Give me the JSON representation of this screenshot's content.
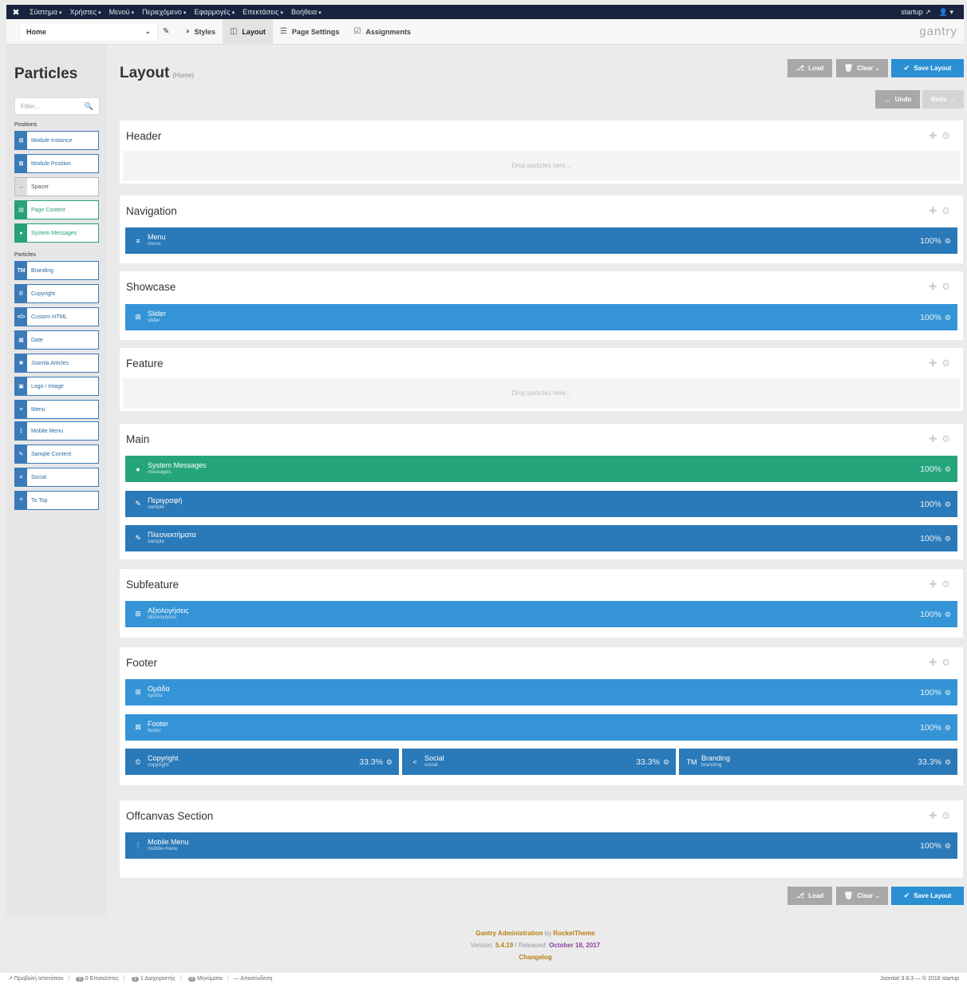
{
  "topbar": {
    "menus": [
      "Σύστημα",
      "Χρήστες",
      "Μενού",
      "Περιεχόμενο",
      "Εφαρμογές",
      "Επεκτάσεις",
      "Βοήθεια"
    ],
    "site_label": "startup"
  },
  "toolbar": {
    "template": "Home",
    "tabs": [
      "Styles",
      "Layout",
      "Page Settings",
      "Assignments"
    ],
    "brand": "gantry"
  },
  "sidebar": {
    "title": "Particles",
    "filter_placeholder": "Filter...",
    "positions_label": "Positions",
    "particles_label": "Particles",
    "positions": [
      "Module Instance",
      "Module Position",
      "Spacer",
      "Page Content",
      "System Messages"
    ],
    "particles": [
      "Branding",
      "Copyright",
      "Custom HTML",
      "Date",
      "Joomla Articles",
      "Logo / Image",
      "Menu",
      "Mobile Menu",
      "Sample Content",
      "Social",
      "To Top"
    ]
  },
  "main": {
    "title": "Layout",
    "subtitle": "(Home)",
    "load": "Load",
    "clear": "Clear",
    "save": "Save Layout",
    "undo": "Undo",
    "redo": "Redo",
    "drop_text": "Drop particles here..."
  },
  "sections": {
    "header": "Header",
    "navigation": "Navigation",
    "showcase": "Showcase",
    "feature": "Feature",
    "main": "Main",
    "subfeature": "Subfeature",
    "footer": "Footer",
    "offcanvas": "Offcanvas Section"
  },
  "rows": {
    "menu": {
      "name": "Menu",
      "key": "menu",
      "pct": "100%"
    },
    "slider": {
      "name": "Slider",
      "key": "slider",
      "pct": "100%"
    },
    "messages": {
      "name": "System Messages",
      "key": "messages",
      "pct": "100%"
    },
    "desc": {
      "name": "Περιγραφή",
      "key": "sample",
      "pct": "100%"
    },
    "adv": {
      "name": "Πλεονεκτήματα",
      "key": "sample",
      "pct": "100%"
    },
    "reviews": {
      "name": "Αξιολογήσεις",
      "key": "αξιολογήσεις",
      "pct": "100%"
    },
    "team": {
      "name": "Ομάδα",
      "key": "ομάδα",
      "pct": "100%"
    },
    "footerpos": {
      "name": "Footer",
      "key": "footer",
      "pct": "100%"
    },
    "copyright": {
      "name": "Copyright",
      "key": "copyright",
      "pct": "33.3%"
    },
    "social": {
      "name": "Social",
      "key": "social",
      "pct": "33.3%"
    },
    "branding": {
      "name": "Branding",
      "key": "branding",
      "pct": "33.3%"
    },
    "mobilemenu": {
      "name": "Mobile Menu",
      "key": "mobile-menu",
      "pct": "100%"
    }
  },
  "footer": {
    "line1a": "Gantry Administration",
    "line1b": "by",
    "line1c": "RocketTheme",
    "line2a": "Version:",
    "line2b": "5.4.19",
    "line2c": "/ Released:",
    "line2d": "October 18, 2017",
    "changelog": "Changelog"
  },
  "statusbar": {
    "view_site": "Προβολή Ιστοτόπου",
    "visitors_count": "0",
    "visitors": "0 Επισκέπτες",
    "admins_count": "1",
    "admins": "1 Διαχειριστής",
    "messages_count": "0",
    "messages": "Μηνύματα",
    "logout": "Αποσύνδεση",
    "version": "Joomla! 3.8.3 — © 2018 startup"
  },
  "colors": {
    "topbar": "#17233f",
    "row_dark": "#2a79b8",
    "row_light": "#3494d6",
    "row_green": "#26a57c",
    "save": "#2a8fd3"
  }
}
